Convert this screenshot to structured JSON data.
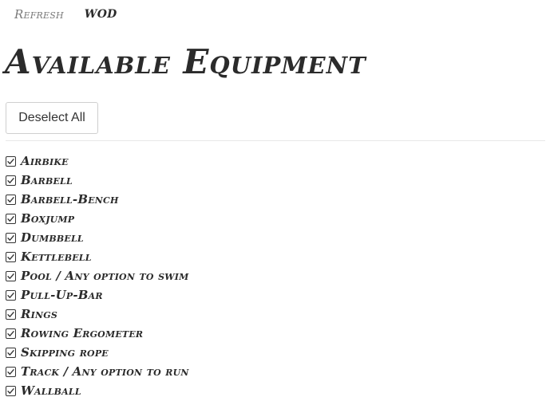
{
  "nav": {
    "refresh_label": "Refresh",
    "wod_label": "WOD"
  },
  "page": {
    "title": "Available Equipment"
  },
  "actions": {
    "deselect_all_label": "Deselect All"
  },
  "equipment": [
    {
      "label": "Airbike",
      "checked": true
    },
    {
      "label": "Barbell",
      "checked": true
    },
    {
      "label": "Barbell-Bench",
      "checked": true
    },
    {
      "label": "Boxjump",
      "checked": true
    },
    {
      "label": "Dumbbell",
      "checked": true
    },
    {
      "label": "Kettlebell",
      "checked": true
    },
    {
      "label": "Pool / Any option to swim",
      "checked": true
    },
    {
      "label": "Pull-Up-Bar",
      "checked": true
    },
    {
      "label": "Rings",
      "checked": true
    },
    {
      "label": "Rowing Ergometer",
      "checked": true
    },
    {
      "label": "Skipping rope",
      "checked": true
    },
    {
      "label": "Track / Any option to run",
      "checked": true
    },
    {
      "label": "Wallball",
      "checked": true
    }
  ],
  "icons": {
    "checkbox": "check-icon"
  },
  "colors": {
    "text": "#2b2b2b",
    "muted_nav": "#7a7a7a",
    "button_border": "#cfcfcf",
    "divider": "#e8e8e8"
  }
}
